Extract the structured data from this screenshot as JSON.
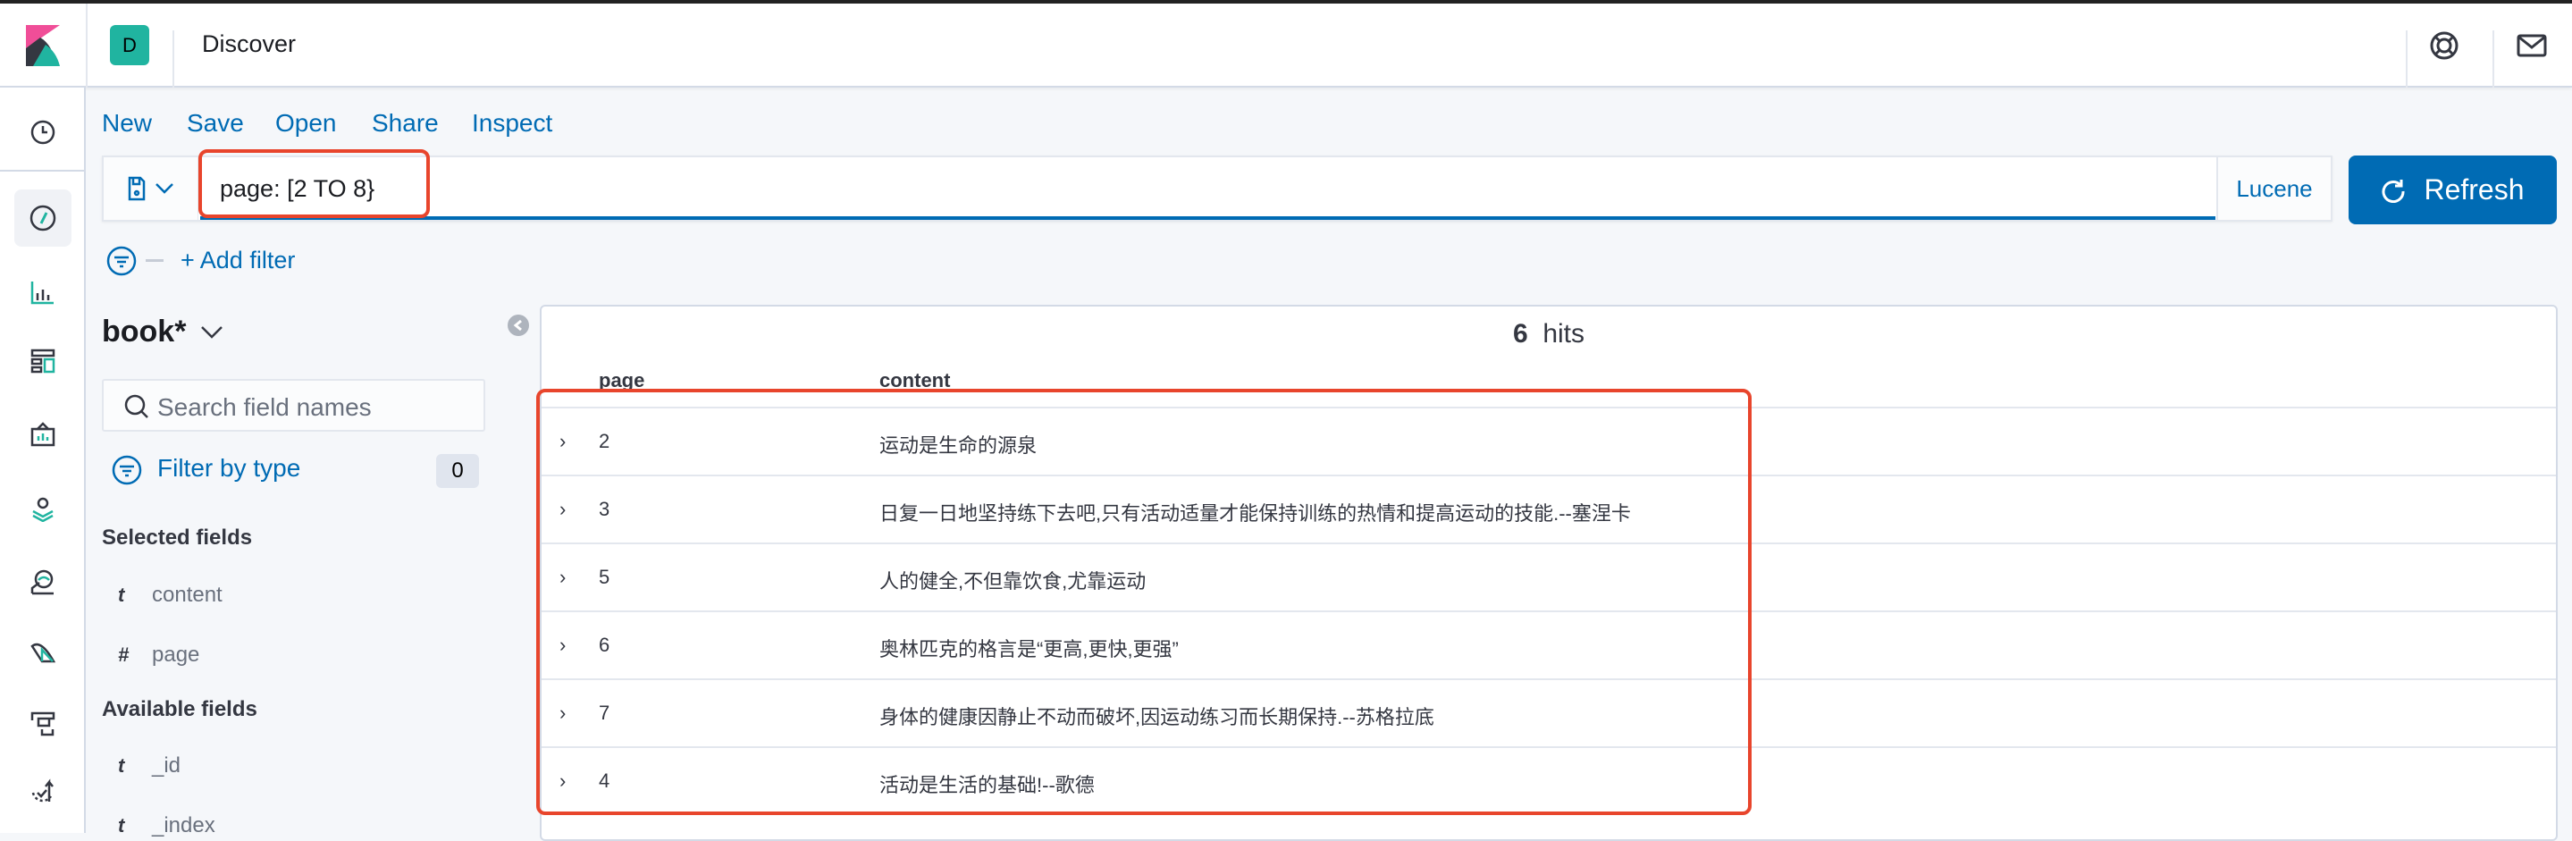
{
  "app": {
    "title": "Discover",
    "space_initial": "D",
    "space_color": "#20b4a0"
  },
  "colors": {
    "accent": "#006bb4",
    "annotation": "#e8452c"
  },
  "header_icons": [
    "help-lifebuoy-icon",
    "mail-icon"
  ],
  "nav_icons": [
    "clock-icon",
    "discover-compass-icon",
    "visualize-icon",
    "dashboard-icon",
    "canvas-icon",
    "maps-icon",
    "ml-icon",
    "infrastructure-icon",
    "apm-icon",
    "uptime-icon"
  ],
  "menu": {
    "new": "New",
    "save": "Save",
    "open": "Open",
    "share": "Share",
    "inspect": "Inspect"
  },
  "query": {
    "value": "page: [2 TO 8}",
    "language": "Lucene",
    "refresh": "Refresh"
  },
  "filter": {
    "add": "+ Add filter"
  },
  "sidebar": {
    "index_pattern": "book*",
    "search_placeholder": "Search field names",
    "filter_by_type": "Filter by type",
    "filter_count": "0",
    "selected_title": "Selected fields",
    "selected": [
      {
        "type": "t",
        "name": "content"
      },
      {
        "type": "#",
        "name": "page"
      }
    ],
    "available_title": "Available fields",
    "available": [
      {
        "type": "t",
        "name": "_id"
      },
      {
        "type": "t",
        "name": "_index"
      }
    ]
  },
  "results": {
    "hits_count": "6",
    "hits_label": "hits",
    "columns": [
      "page",
      "content"
    ],
    "rows": [
      {
        "page": "2",
        "content": "运动是生命的源泉"
      },
      {
        "page": "3",
        "content": "日复一日地坚持练下去吧,只有活动适量才能保持训练的热情和提高运动的技能.--塞涅卡"
      },
      {
        "page": "5",
        "content": "人的健全,不但靠饮食,尤靠运动"
      },
      {
        "page": "6",
        "content": "奥林匹克的格言是“更高,更快,更强”"
      },
      {
        "page": "7",
        "content": "身体的健康因静止不动而破坏,因运动练习而长期保持.--苏格拉底"
      },
      {
        "page": "4",
        "content": "活动是生活的基础!--歌德"
      }
    ]
  }
}
